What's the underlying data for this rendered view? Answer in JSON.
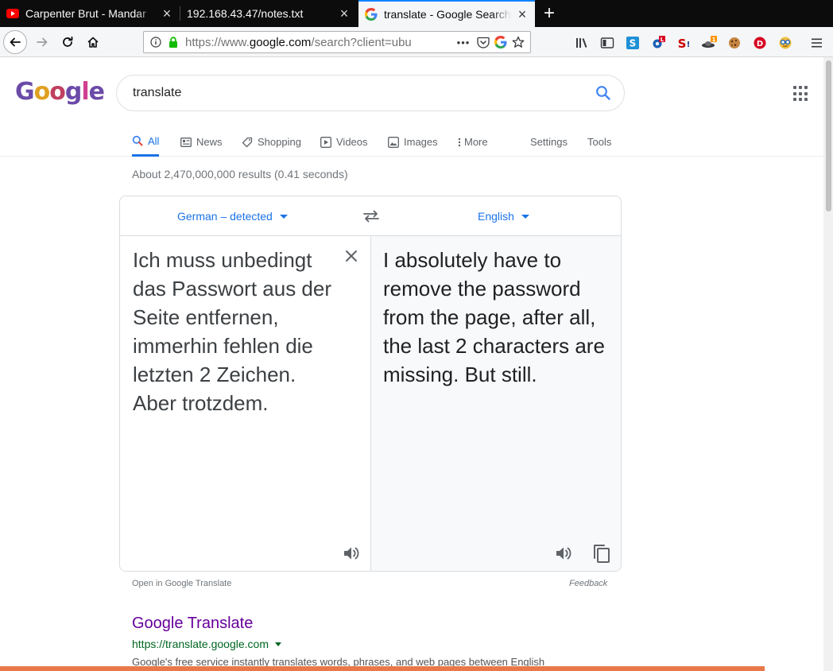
{
  "browser": {
    "tabs": [
      {
        "title": "Carpenter Brut - Mandar",
        "favicon": "youtube-icon"
      },
      {
        "title": "192.168.43.47/notes.txt",
        "favicon": "none"
      },
      {
        "title": "translate - Google Search",
        "favicon": "google-g-icon",
        "active": true
      }
    ],
    "new_tab_label": "+",
    "url_prefix": "https://www.",
    "url_domain": "google.com",
    "url_rest": "/search?client=ubu",
    "page_actions": "•••",
    "extension_badges": {
      "l": "L",
      "one": "1"
    }
  },
  "google": {
    "logo_letters": [
      "G",
      "o",
      "o",
      "g",
      "l",
      "e"
    ],
    "query": "translate",
    "tabs": [
      {
        "label": "All",
        "icon": "search-icon"
      },
      {
        "label": "News",
        "icon": "news-icon"
      },
      {
        "label": "Shopping",
        "icon": "tag-icon"
      },
      {
        "label": "Videos",
        "icon": "play-icon"
      },
      {
        "label": "Images",
        "icon": "image-icon"
      },
      {
        "label": "More",
        "icon": "more-vert-icon"
      },
      {
        "label": "Settings"
      },
      {
        "label": "Tools"
      }
    ],
    "stats": "About 2,470,000,000 results (0.41 seconds)"
  },
  "translate": {
    "source_lang": "German – detected",
    "target_lang": "English",
    "source_text": "Ich muss unbedingt das Passwort aus der Seite entfernen, immerhin fehlen die letzten 2 Zeichen. Aber trotzdem.",
    "target_text": "I absolutely have to remove the password from the page, after all, the last 2 characters are missing. But still.",
    "open_link": "Open in Google Translate",
    "feedback": "Feedback"
  },
  "result": {
    "title": "Google Translate",
    "url": "https://translate.google.com",
    "snippet": "Google's free service instantly translates words, phrases, and web pages between English"
  },
  "colors": {
    "accent_blue": "#1a73e8",
    "visited_purple": "#660099",
    "url_green": "#006621",
    "firefox_tab_highlight": "#0a84ff"
  }
}
